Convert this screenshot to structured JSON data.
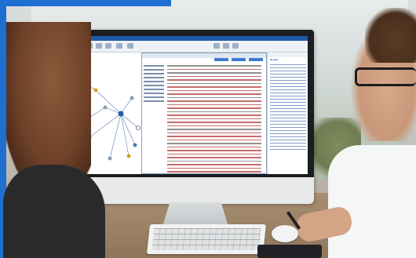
{
  "scene": {
    "description_tags": [
      "office-photo",
      "monitor",
      "analysis-software"
    ],
    "colors": {
      "accent_blue": "#1f6fd1",
      "app_titlebar": "#1f5aa8",
      "doc_highlight": "#b23a3a"
    }
  },
  "screen": {
    "right_pane_label": "Results"
  }
}
